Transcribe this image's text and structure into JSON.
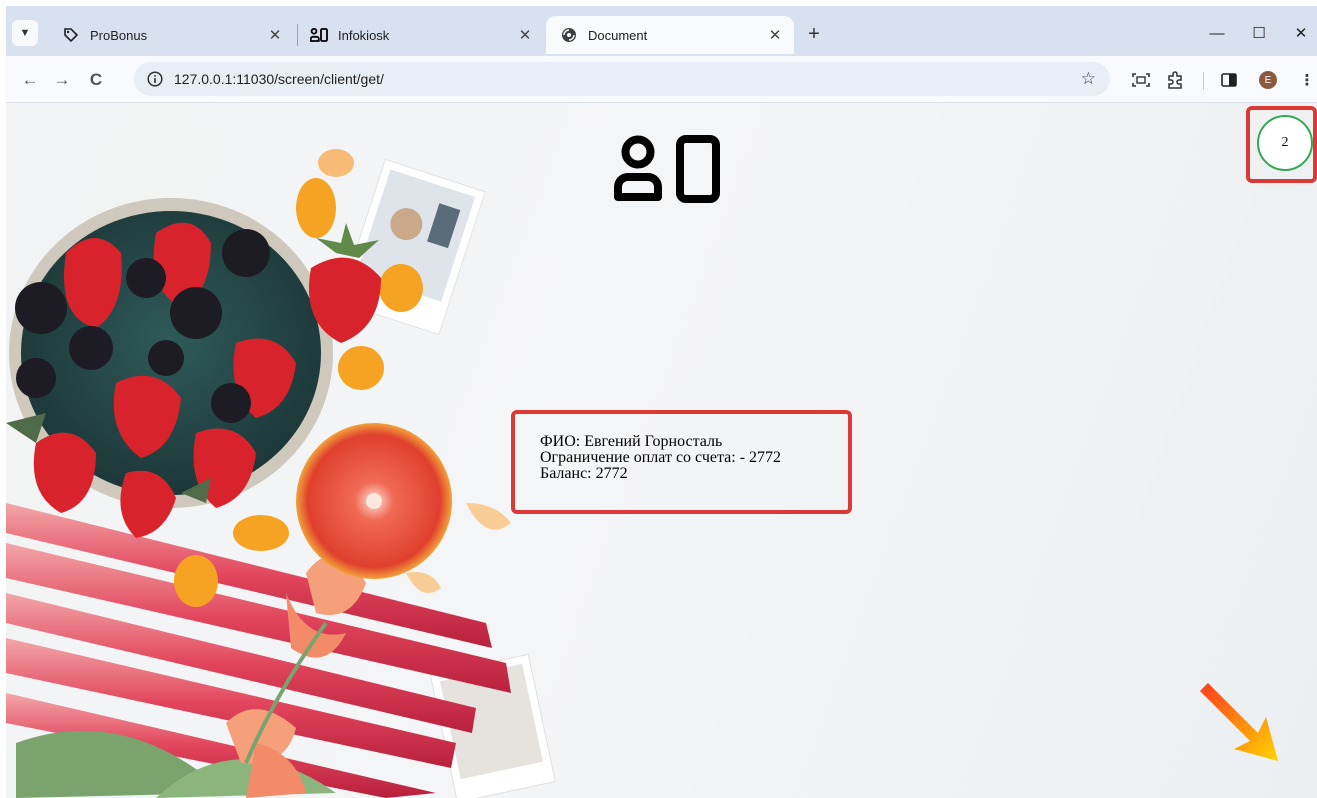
{
  "browser": {
    "tabs": [
      {
        "label": "ProBonus",
        "active": false
      },
      {
        "label": "Infokiosk",
        "active": false
      },
      {
        "label": "Document",
        "active": true
      }
    ],
    "new_tab_icon": "plus-icon",
    "window_controls": [
      "minimize-icon",
      "maximize-icon",
      "close-icon"
    ],
    "url": "127.0.0.1:11030/screen/client/get/",
    "toolbar_icons": [
      "back-icon",
      "forward-icon",
      "reload-icon",
      "site-info-icon",
      "bookmark-star-icon",
      "screen-capture-icon",
      "extensions-icon",
      "side-panel-icon",
      "profile-avatar",
      "menu-icon"
    ],
    "profile_initial": "E"
  },
  "page": {
    "logo_icon": "infokiosk-logo-icon",
    "counter": "2",
    "client": {
      "name_line": "ФИО: Евгений Горносталь",
      "limit_line": "Ограничение оплат со счета: - 2772",
      "balance_line": "Баланс: 2772"
    },
    "colors": {
      "highlight_border": "#d93a35",
      "counter_ring": "#34a853",
      "arrow_gradient": [
        "#ff3b1f",
        "#ffd400"
      ]
    }
  }
}
